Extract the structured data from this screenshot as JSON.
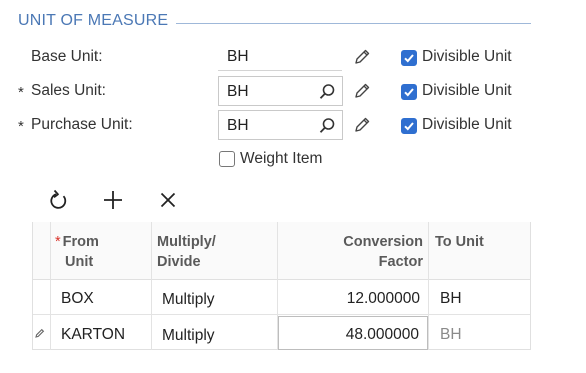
{
  "section": {
    "title": "UNIT OF MEASURE"
  },
  "form": {
    "base_unit": {
      "label": "Base Unit:",
      "value": "BH",
      "divisible_label": "Divisible Unit",
      "divisible_checked": true
    },
    "sales_unit": {
      "required_mark": "*",
      "label": "Sales Unit:",
      "value": "BH",
      "divisible_label": "Divisible Unit",
      "divisible_checked": true
    },
    "purchase_unit": {
      "required_mark": "*",
      "label": "Purchase Unit:",
      "value": "BH",
      "divisible_label": "Divisible Unit",
      "divisible_checked": true
    },
    "weight_item": {
      "label": "Weight Item",
      "checked": false
    }
  },
  "toolbar": {
    "icons": [
      "refresh-icon",
      "add-icon",
      "delete-icon"
    ]
  },
  "grid": {
    "columns": [
      {
        "required_mark": "*",
        "line1": "From",
        "line2": "Unit"
      },
      {
        "line1": "Multiply/",
        "line2": "Divide"
      },
      {
        "line1": "Conversion",
        "line2": "Factor"
      },
      {
        "line1": "To Unit",
        "line2": ""
      }
    ],
    "rows": [
      {
        "from_unit": "BOX",
        "multiply_divide": "Multiply",
        "conversion_factor": "12.000000",
        "to_unit": "BH"
      },
      {
        "from_unit": "KARTON",
        "multiply_divide": "Multiply",
        "conversion_factor": "48.000000",
        "to_unit": "BH"
      }
    ]
  },
  "colors": {
    "accent": "#2f6fd0",
    "section_title": "#4b78b5"
  }
}
